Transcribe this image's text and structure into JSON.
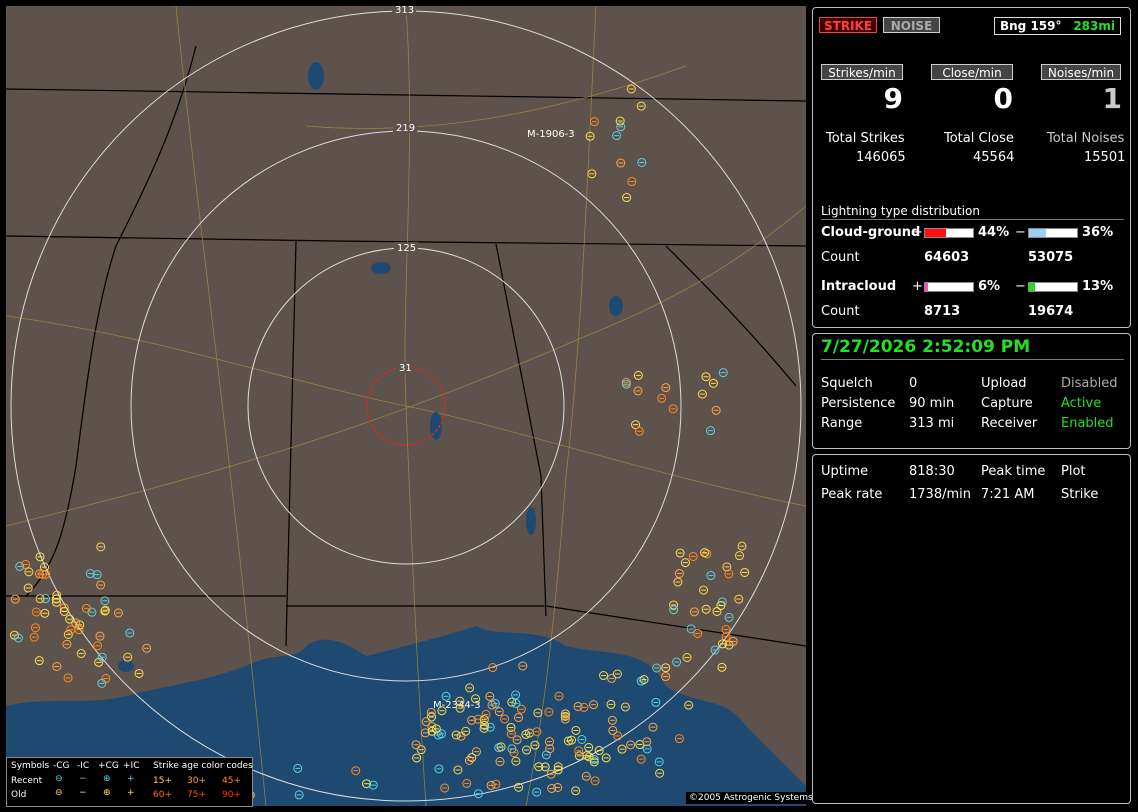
{
  "map": {
    "ring_labels": [
      "313",
      "219",
      "125",
      "31"
    ],
    "site_labels": [
      "M-1906-3",
      "M-2344-3"
    ],
    "copyright": "©2005 Astrogenic Systems"
  },
  "legend": {
    "header_symbols": "Symbols",
    "col_neg_cg": "-CG",
    "col_neg_ic": "-IC",
    "col_pos_cg": "+CG",
    "col_pos_ic": "+IC",
    "header_age": "Strike age color codes",
    "row_recent": "Recent",
    "row_old": "Old",
    "ages": [
      "15+",
      "30+",
      "45+",
      "60+",
      "75+",
      "90+"
    ],
    "age_colors": [
      "#ffd24a",
      "#ffa640",
      "#ff8a20",
      "#ff6a10",
      "#ff5000",
      "#ff3000"
    ]
  },
  "panel1": {
    "strike_btn": "STRIKE",
    "noise_btn": "NOISE",
    "bearing": "Bng 159°",
    "distance": "283mi",
    "rate_strikes_label": "Strikes/min",
    "rate_close_label": "Close/min",
    "rate_noises_label": "Noises/min",
    "rate_strikes": "9",
    "rate_close": "0",
    "rate_noises": "1",
    "total_strikes_label": "Total Strikes",
    "total_close_label": "Total Close",
    "total_noises_label": "Total Noises",
    "total_strikes": "146065",
    "total_close": "45564",
    "total_noises": "15501",
    "dist_title": "Lightning type distribution",
    "cg_label": "Cloud-ground",
    "plus": "+",
    "minus": "−",
    "cg_pos_pct": "44%",
    "cg_neg_pct": "36%",
    "count_label": "Count",
    "cg_pos_count": "64603",
    "cg_neg_count": "53075",
    "ic_label": "Intracloud",
    "ic_pos_pct": "6%",
    "ic_neg_pct": "13%",
    "ic_pos_count": "8713",
    "ic_neg_count": "19674",
    "bar_fractions": {
      "cg_pos": 0.44,
      "cg_neg": 0.36,
      "ic_pos": 0.06,
      "ic_neg": 0.13
    },
    "colors": {
      "cg_pos": "#ff1010",
      "cg_neg": "#9ecdf5",
      "ic_pos": "#ff4fb0",
      "ic_neg": "#22dd22"
    }
  },
  "panel2": {
    "datetime": "7/27/2026 2:52:09 PM",
    "squelch_label": "Squelch",
    "squelch": "0",
    "persistence_label": "Persistence",
    "persistence": "90 min",
    "range_label": "Range",
    "range": "313 mi",
    "upload_label": "Upload",
    "upload": "Disabled",
    "capture_label": "Capture",
    "capture": "Active",
    "receiver_label": "Receiver",
    "receiver": "Enabled"
  },
  "panel3": {
    "uptime_label": "Uptime",
    "uptime": "818:30",
    "peak_time_label": "Peak time",
    "peak_time": "7:21 AM",
    "plot_label": "Plot",
    "plot": "Strike",
    "peak_rate_label": "Peak rate",
    "peak_rate": "1738/min"
  }
}
